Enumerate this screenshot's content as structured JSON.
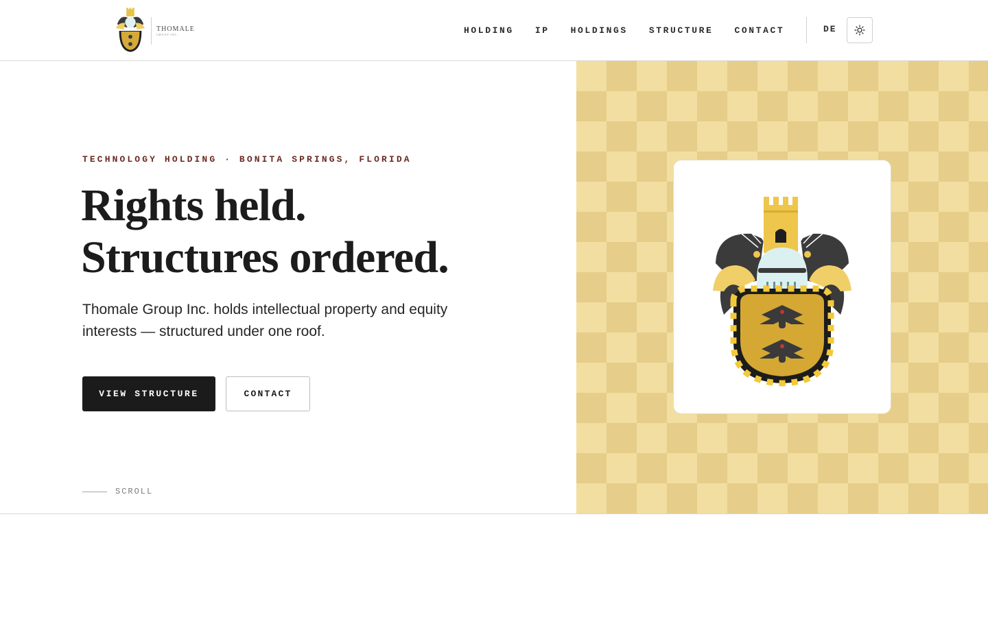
{
  "header": {
    "logo": {
      "name": "THOMALE",
      "sub": "GROUP INC."
    },
    "nav": [
      {
        "label": "HOLDING"
      },
      {
        "label": "IP"
      },
      {
        "label": "HOLDINGS"
      },
      {
        "label": "STRUCTURE"
      },
      {
        "label": "CONTACT"
      }
    ],
    "language": "DE",
    "theme_toggle_icon": "sun-icon"
  },
  "hero": {
    "eyebrow": "TECHNOLOGY HOLDING · BONITA SPRINGS, FLORIDA",
    "headline_line1": "Rights held.",
    "headline_line2": "Structures ordered.",
    "lede": "Thomale Group Inc. holds intellectual property and equity interests — structured under one roof.",
    "primary_button": "VIEW STRUCTURE",
    "secondary_button": "CONTACT",
    "scroll_label": "SCROLL"
  },
  "colors": {
    "accent_text": "#6b2a1f",
    "checker_light": "#f2dea0",
    "checker_dark": "#e6cd89",
    "button_dark": "#1b1b1b"
  }
}
